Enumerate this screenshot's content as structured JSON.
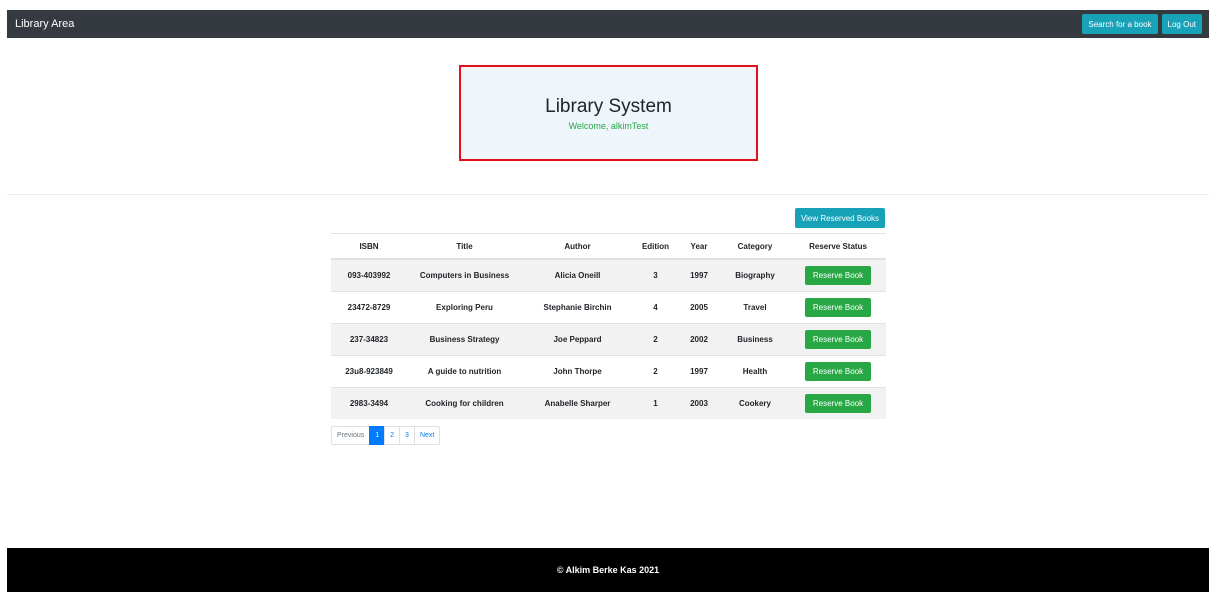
{
  "navbar": {
    "brand": "Library Area",
    "search_label": "Search for a book",
    "logout_label": "Log Out"
  },
  "hero": {
    "title": "Library System",
    "welcome": "Welcome, alkimTest"
  },
  "actions": {
    "view_reserved_label": "View Reserved Books"
  },
  "table": {
    "headers": [
      "ISBN",
      "Title",
      "Author",
      "Edition",
      "Year",
      "Category",
      "Reserve Status"
    ],
    "rows": [
      {
        "isbn": "093-403992",
        "title": "Computers in Business",
        "author": "Alicia Oneill",
        "edition": "3",
        "year": "1997",
        "category": "Biography",
        "action": "Reserve Book"
      },
      {
        "isbn": "23472-8729",
        "title": "Exploring Peru",
        "author": "Stephanie Birchin",
        "edition": "4",
        "year": "2005",
        "category": "Travel",
        "action": "Reserve Book"
      },
      {
        "isbn": "237-34823",
        "title": "Business Strategy",
        "author": "Joe Peppard",
        "edition": "2",
        "year": "2002",
        "category": "Business",
        "action": "Reserve Book"
      },
      {
        "isbn": "23u8-923849",
        "title": "A guide to nutrition",
        "author": "John Thorpe",
        "edition": "2",
        "year": "1997",
        "category": "Health",
        "action": "Reserve Book"
      },
      {
        "isbn": "2983-3494",
        "title": "Cooking for children",
        "author": "Anabelle Sharper",
        "edition": "1",
        "year": "2003",
        "category": "Cookery",
        "action": "Reserve Book"
      }
    ]
  },
  "pagination": {
    "previous": "Previous",
    "pages": [
      "1",
      "2",
      "3"
    ],
    "active_page": "1",
    "next": "Next"
  },
  "footer": {
    "text": "© Alkim Berke Kas 2021"
  },
  "colors": {
    "navbar": "#343a40",
    "info": "#17a2b8",
    "success": "#28a745",
    "hero_border": "#e3101b",
    "primary": "#007bff"
  }
}
